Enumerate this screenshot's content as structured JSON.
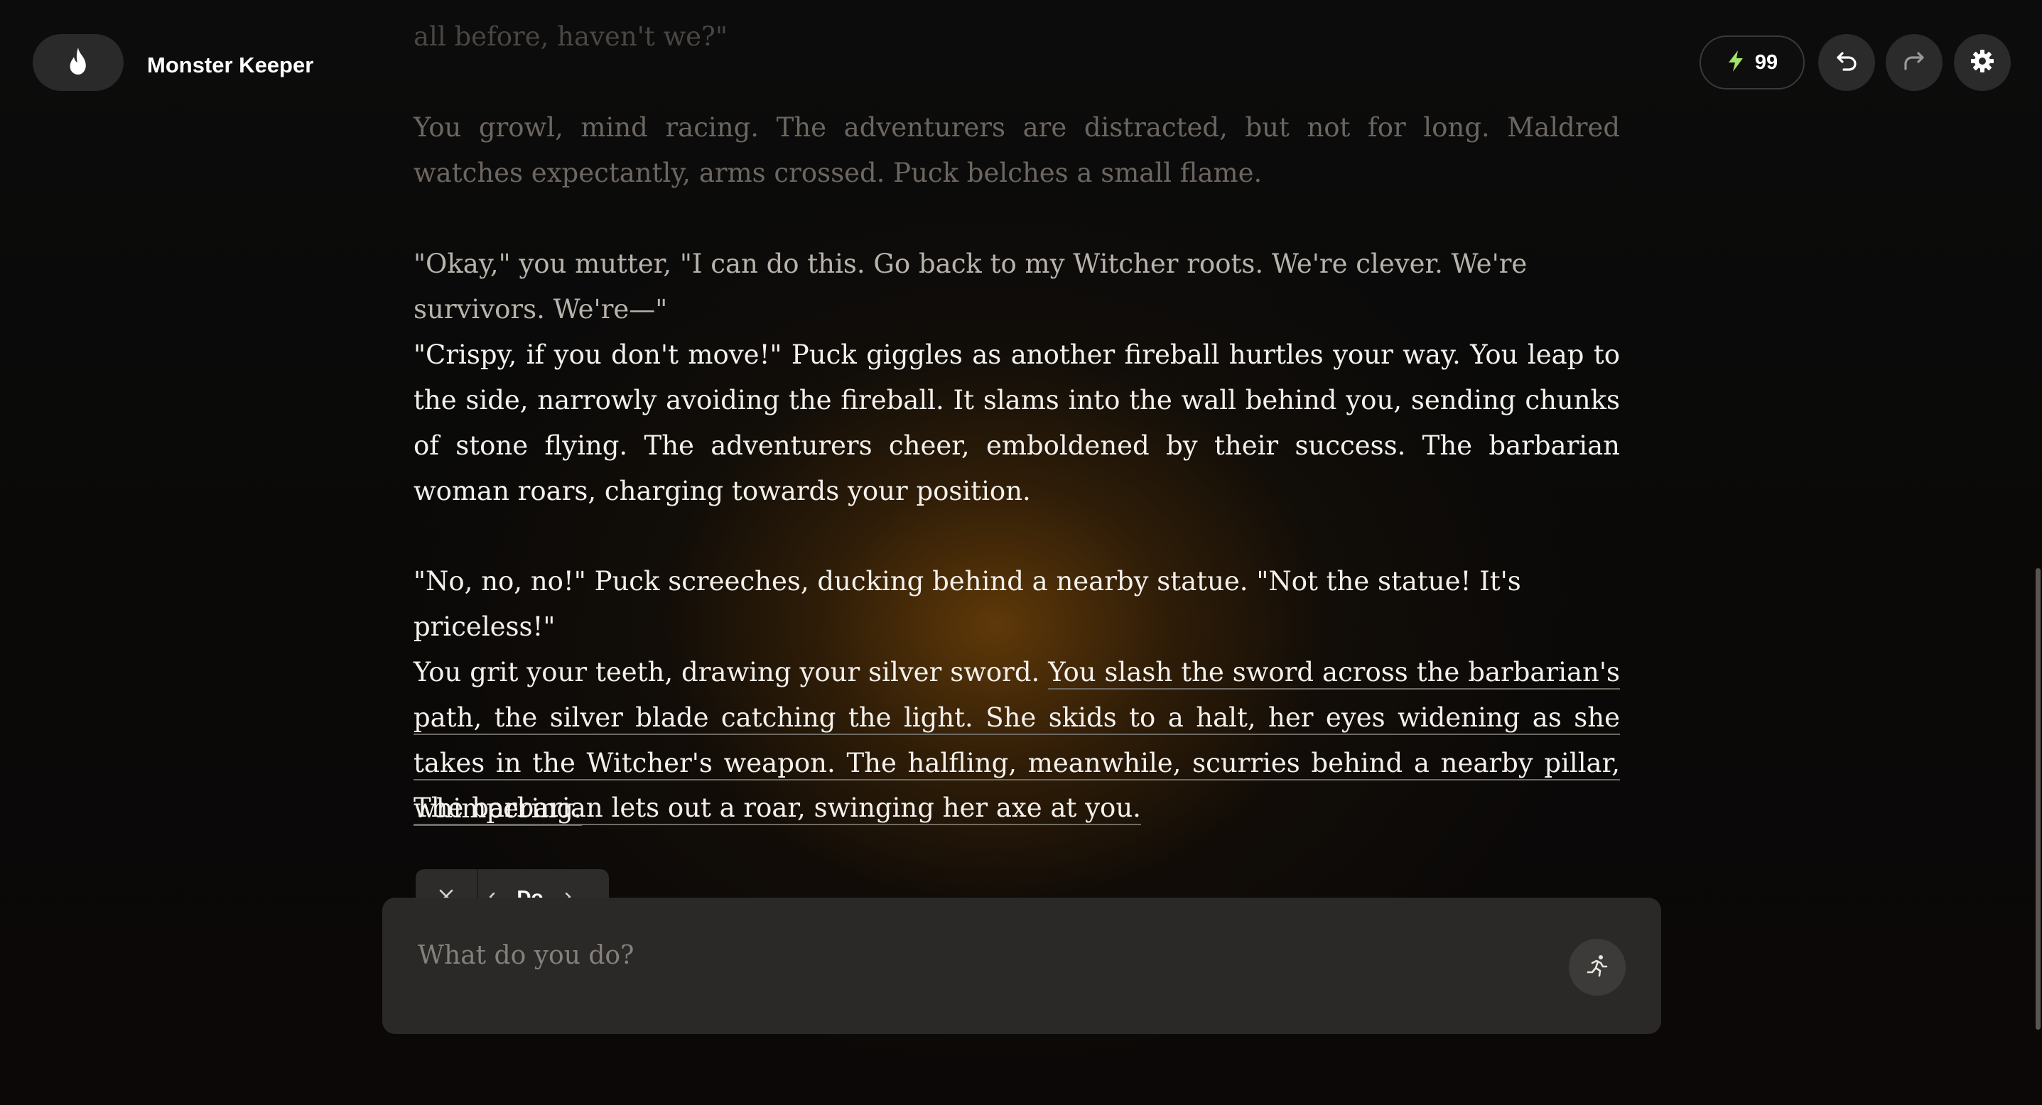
{
  "app": {
    "title": "Monster Keeper",
    "logo_icon": "flame-icon"
  },
  "toolbar": {
    "energy_icon": "lightning-bolt-icon",
    "energy_count": "99",
    "undo_icon": "undo-icon",
    "redo_icon": "redo-icon",
    "settings_icon": "gear-icon",
    "energy_color": "#9be15d"
  },
  "story": {
    "faded_line": "all before, haven't we?\"",
    "paragraphs": [
      "You growl, mind racing. The adventurers are distracted, but not for long. Maldred watches expectantly, arms crossed. Puck belches a small flame.",
      "\"Okay,\" you mutter, \"I can do this. Go back to my Witcher roots. We're clever. We're survivors. We're—\"",
      "\"Crispy, if you don't move!\" Puck giggles as another fireball hurtles your way. You leap to the side, narrowly avoiding the fireball. It slams into the wall behind you, sending chunks of stone flying. The adventurers cheer, emboldened by their success. The barbarian woman roars, charging towards your position."
    ],
    "p5_line1": "\"No, no, no!\" Puck screeches, ducking behind a nearby statue. \"Not the statue! It's priceless!\"",
    "p5_plain": "You grit your teeth, drawing your silver sword.",
    "p5_highlight": "You slash the sword across the barbarian's path, the silver blade catching the light. She skids to a halt, her eyes widening as she takes in the Witcher's weapon. The halfling, meanwhile, scurries behind a nearby pillar, whimpering.",
    "p6_highlight": "The barbarian lets out a roar, swinging her axe at you."
  },
  "action": {
    "mode_label": "Do",
    "close_icon": "close-icon",
    "prev_icon": "chevron-left-icon",
    "next_icon": "chevron-right-icon",
    "input_placeholder": "What do you do?",
    "input_value": "",
    "submit_icon": "running-figure-icon"
  }
}
